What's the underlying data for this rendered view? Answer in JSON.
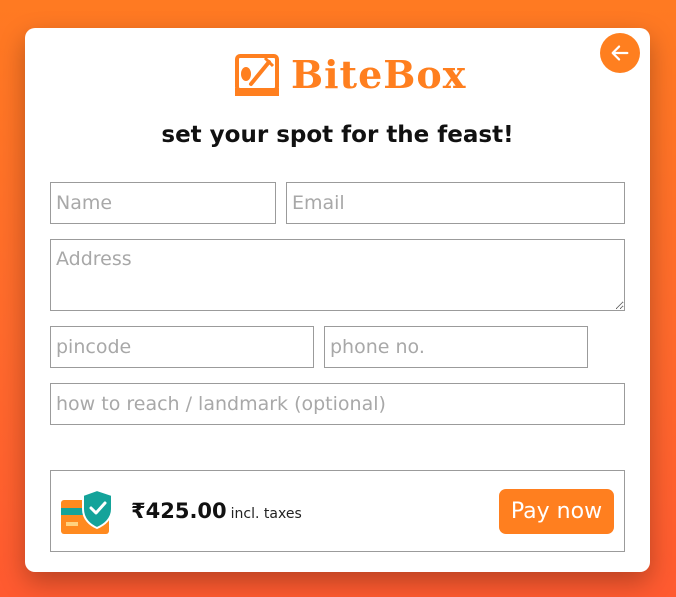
{
  "brand": {
    "name": "BiteBox",
    "primary_color": "#ff7f1f"
  },
  "header": {
    "back_icon": "arrow-left-icon",
    "title": "set your spot for the feast!"
  },
  "form": {
    "name_placeholder": "Name",
    "email_placeholder": "Email",
    "address_placeholder": "Address",
    "pincode_placeholder": "pincode",
    "phone_placeholder": "phone no.",
    "landmark_placeholder": "how to reach / landmark (optional)"
  },
  "payment": {
    "icon": "secure-card-payment-icon",
    "price": "₹425.00",
    "taxes_note": "incl. taxes",
    "pay_button": "Pay now"
  }
}
